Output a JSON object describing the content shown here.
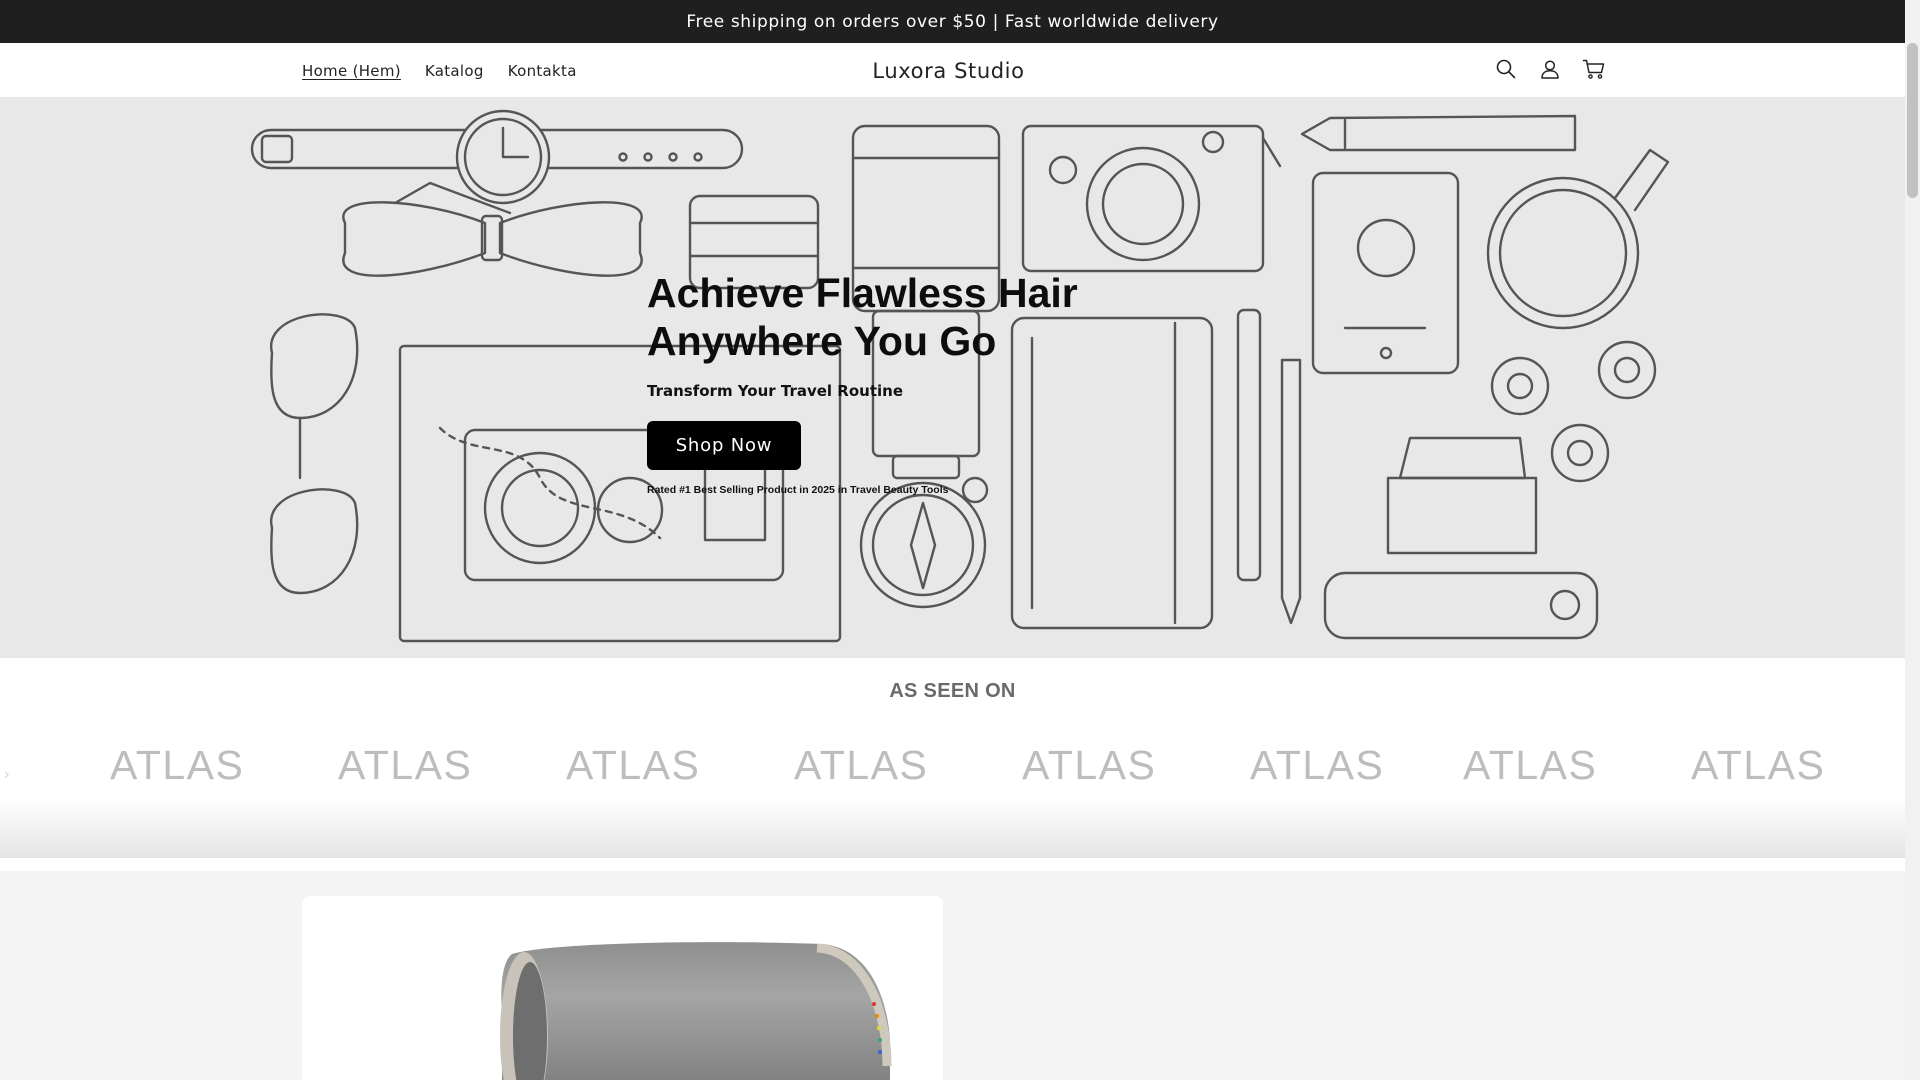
{
  "announcement": {
    "text": "Free shipping on orders over $50 | Fast worldwide delivery"
  },
  "header": {
    "nav": [
      {
        "label": "Home (Hem)",
        "active": true
      },
      {
        "label": "Katalog",
        "active": false
      },
      {
        "label": "Kontakta",
        "active": false
      }
    ],
    "brand": "Luxora Studio",
    "icons": [
      "search-icon",
      "account-icon",
      "cart-icon"
    ]
  },
  "hero": {
    "title": "Achieve Flawless Hair Anywhere You Go",
    "subtitle": "Transform Your Travel Routine",
    "cta_label": "Shop Now",
    "rating_text": "Rated #1 Best Selling Product in 2025 in Travel Beauty Tools",
    "background_color": "#e8e8e8"
  },
  "as_seen_on": {
    "heading": "AS SEEN ON",
    "logos": [
      "ATLAS",
      "ATLAS",
      "ATLAS",
      "ATLAS",
      "ATLAS",
      "ATLAS",
      "ATLAS",
      "ATLAS"
    ]
  },
  "colors": {
    "announcement_bg": "#1f1f1f",
    "button_bg": "#000000",
    "logo_gray": "#bdbdbd"
  }
}
